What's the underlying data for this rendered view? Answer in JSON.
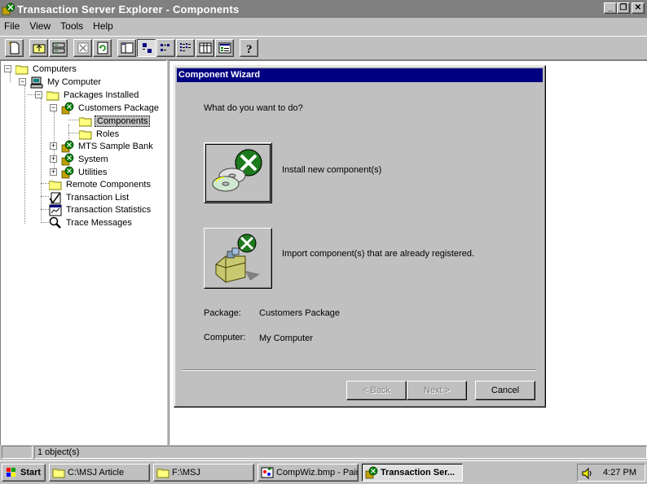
{
  "window": {
    "title": "Transaction Server Explorer - Components",
    "controls": {
      "minimize": "_",
      "restore": "❐",
      "close": "✕"
    }
  },
  "menubar": {
    "items": [
      {
        "label": "File"
      },
      {
        "label": "View"
      },
      {
        "label": "Tools"
      },
      {
        "label": "Help"
      }
    ]
  },
  "toolbar": {
    "buttons": [
      {
        "icon": "new-icon"
      },
      {
        "icon": "up-folder-icon"
      },
      {
        "icon": "map-drive-icon"
      },
      {
        "icon": "delete-icon"
      },
      {
        "icon": "refresh-icon"
      },
      {
        "icon": "view-toggle-icon"
      },
      {
        "icon": "large-icons-icon"
      },
      {
        "icon": "small-icons-icon"
      },
      {
        "icon": "list-view-icon"
      },
      {
        "icon": "details-view-icon"
      },
      {
        "icon": "properties-icon"
      },
      {
        "icon": "help-icon"
      }
    ]
  },
  "tree": {
    "items": [
      {
        "label": "Computers",
        "icon": "folder-icon"
      },
      {
        "label": "My Computer",
        "icon": "computer-icon"
      },
      {
        "label": "Packages Installed",
        "icon": "folder-icon"
      },
      {
        "label": "Customers Package",
        "icon": "package-icon"
      },
      {
        "label": "Components",
        "icon": "folder-open-icon",
        "selected": true
      },
      {
        "label": "Roles",
        "icon": "folder-icon"
      },
      {
        "label": "MTS Sample Bank",
        "icon": "package-icon"
      },
      {
        "label": "System",
        "icon": "package-icon"
      },
      {
        "label": "Utilities",
        "icon": "package-icon"
      },
      {
        "label": "Remote Components",
        "icon": "folder-icon"
      },
      {
        "label": "Transaction List",
        "icon": "transaction-list-icon"
      },
      {
        "label": "Transaction Statistics",
        "icon": "statistics-icon"
      },
      {
        "label": "Trace Messages",
        "icon": "trace-icon"
      }
    ]
  },
  "wizard": {
    "title": "Component Wizard",
    "question": "What do you want to do?",
    "option_install": "Install new component(s)",
    "option_import": "Import component(s) that are already registered.",
    "package_label": "Package:",
    "package_value": "Customers Package",
    "computer_label": "Computer:",
    "computer_value": "My Computer",
    "back_label": "< Back",
    "next_label": "Next >",
    "cancel_label": "Cancel"
  },
  "statusbar": {
    "text": "1 object(s)"
  },
  "taskbar": {
    "start_label": "Start",
    "tasks": [
      {
        "label": "C:\\MSJ Article",
        "icon": "folder-icon"
      },
      {
        "label": "F:\\MSJ",
        "icon": "folder-icon"
      },
      {
        "label": "CompWiz.bmp - Paint",
        "icon": "paint-icon"
      },
      {
        "label": "Transaction Ser...",
        "icon": "mts-icon",
        "active": true
      }
    ],
    "clock": "4:27 PM"
  },
  "colors": {
    "title_inactive": "#808080",
    "title_active": "#000080",
    "face": "#c0c0c0",
    "mts_green": "#008000"
  }
}
